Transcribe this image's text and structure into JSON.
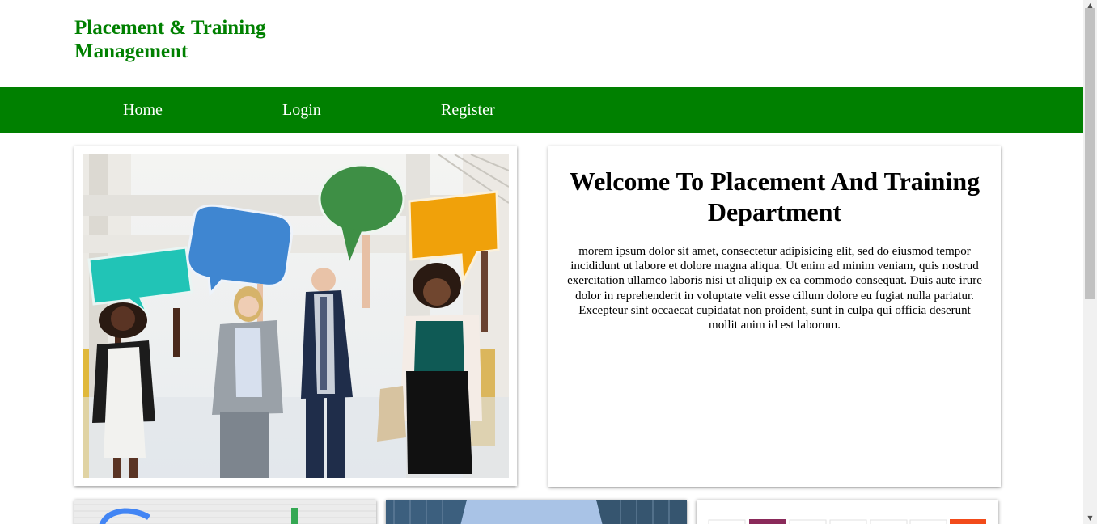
{
  "brand": {
    "line1": "Placement & Training",
    "line2": "Management",
    "color": "#008000"
  },
  "nav": {
    "background": "#008000",
    "items": [
      {
        "label": "Home"
      },
      {
        "label": "Login"
      },
      {
        "label": "Register"
      }
    ]
  },
  "hero": {
    "image": "team-holding-speech-bubbles-photo"
  },
  "welcome": {
    "title": "Welcome To Placement And Training Department",
    "body": "morem ipsum dolor sit amet, consectetur adipisicing elit, sed do eiusmod tempor incididunt ut labore et dolore magna aliqua. Ut enim ad minim veniam, quis nostrud exercitation ullamco laboris nisi ut aliquip ex ea commodo consequat. Duis aute irure dolor in reprehenderit in voluptate velit esse cillum dolore eu fugiat nulla pariatur. Excepteur sint occaecat cupidatat non proident, sunt in culpa qui officia deserunt mollit anim id est laborum."
  },
  "cards": [
    {
      "image": "google-logo-wall-photo"
    },
    {
      "image": "office-buildings-sky-photo"
    },
    {
      "image": "company-logos-strip"
    }
  ],
  "scrollbar": {
    "up": "▲",
    "down": "▼"
  }
}
